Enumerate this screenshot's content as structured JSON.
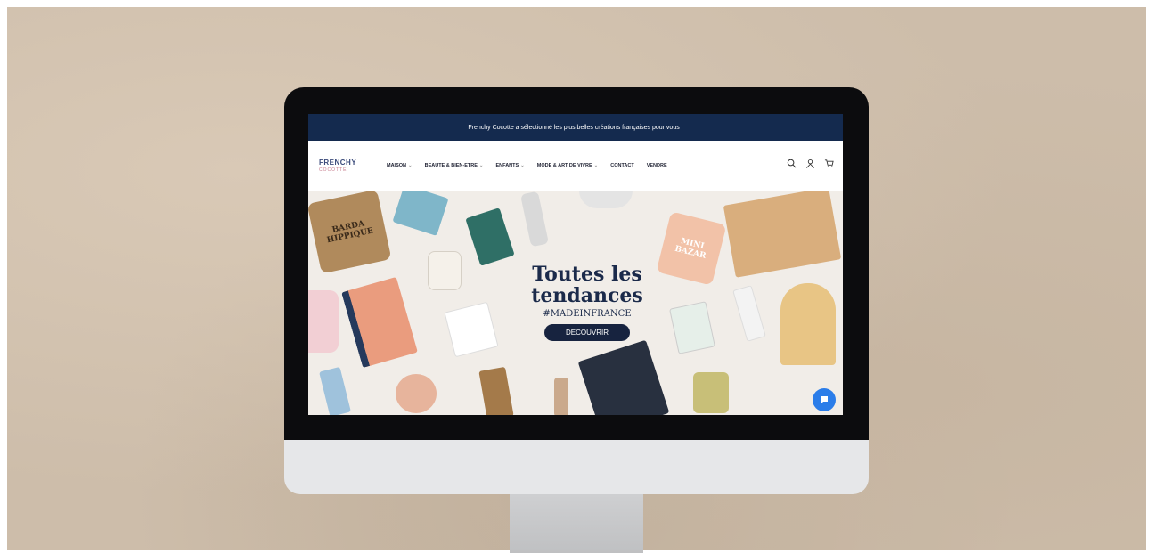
{
  "announcement": "Frenchy Cocotte a sélectionné les plus belles créations françaises pour vous !",
  "logo": {
    "line1": "FRENCHY",
    "line2": "COCOTTE"
  },
  "nav": {
    "items": [
      {
        "label": "MAISON",
        "caret": "⌄"
      },
      {
        "label": "BEAUTE & BIEN-ETRE",
        "caret": "⌄"
      },
      {
        "label": "ENFANTS",
        "caret": "⌄"
      },
      {
        "label": "MODE & ART DE VIVRE",
        "caret": "⌄"
      },
      {
        "label": "CONTACT",
        "caret": ""
      },
      {
        "label": "VENDRE",
        "caret": ""
      }
    ]
  },
  "hero": {
    "title_line1": "Toutes les",
    "title_line2": "tendances",
    "tagline": "#MADEINFRANCE",
    "button": "DECOUVRIR",
    "pouch1_text": "BARDA HIPPIQUE",
    "pouch2_text": "MINI BAZAR"
  },
  "colors": {
    "announce_bg": "#142a4e",
    "hero_bg": "#f1ede8",
    "button_bg": "#17233f",
    "chat": "#2b7de9"
  }
}
